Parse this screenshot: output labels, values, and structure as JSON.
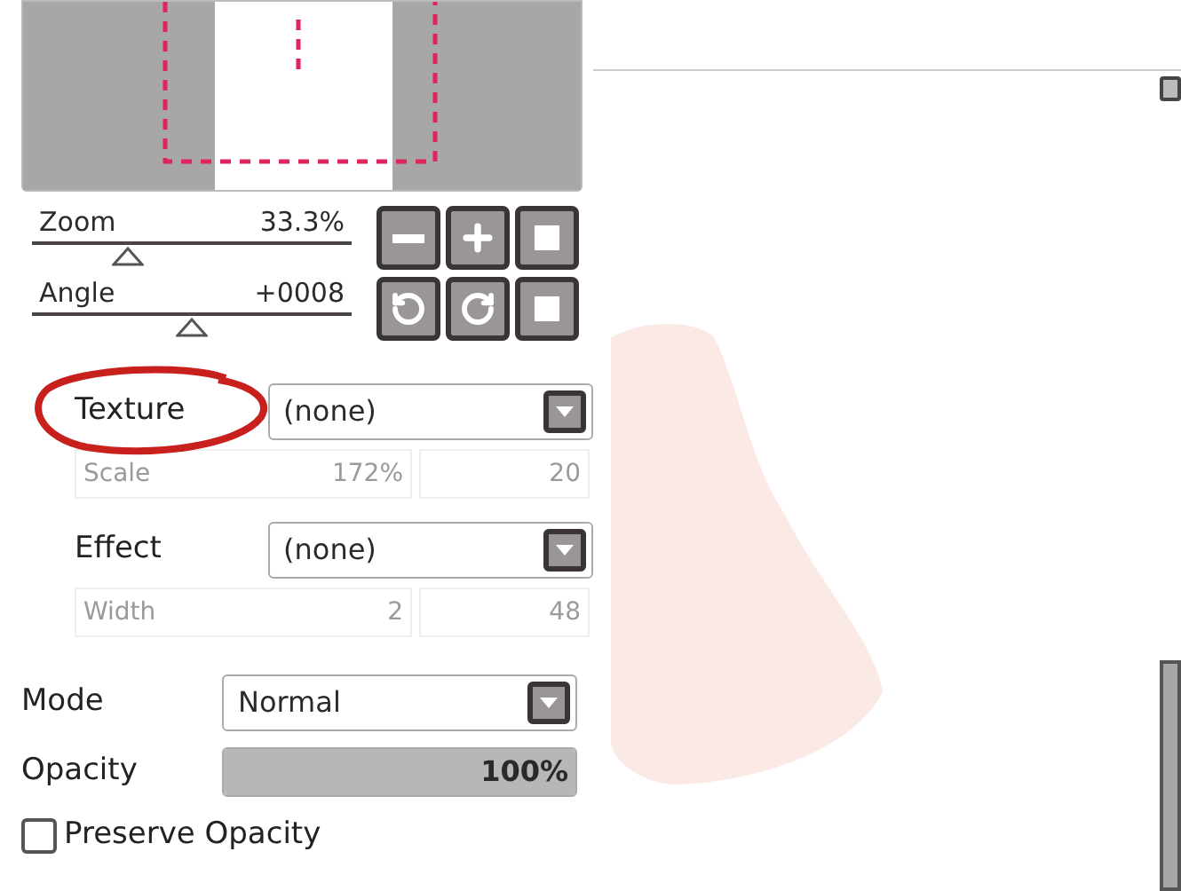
{
  "navigator_sliders": [
    {
      "label": "Zoom",
      "value": "33.3%",
      "level": 0.3
    },
    {
      "label": "Angle",
      "value": "+0008",
      "level": 0.5
    }
  ],
  "view_buttons": [
    {
      "kind": "minus"
    },
    {
      "kind": "plus"
    },
    {
      "kind": "square"
    },
    {
      "kind": "rotate-left"
    },
    {
      "kind": "rotate-right"
    },
    {
      "kind": "square"
    }
  ],
  "texture": {
    "label": "Texture",
    "value": "(none)",
    "circled": true,
    "sub": {
      "label": "Scale",
      "value": "172%",
      "extra": "20",
      "disabled": true
    }
  },
  "effect": {
    "label": "Effect",
    "value": "(none)",
    "circled": false,
    "sub": {
      "label": "Width",
      "value": "2",
      "extra": "48",
      "disabled": true
    }
  },
  "mode": {
    "label": "Mode",
    "value": "Normal"
  },
  "opacity": {
    "label": "Opacity",
    "value": "100%",
    "level": 1
  },
  "preserve_opacity": {
    "label": "Preserve Opacity",
    "checked": false
  }
}
